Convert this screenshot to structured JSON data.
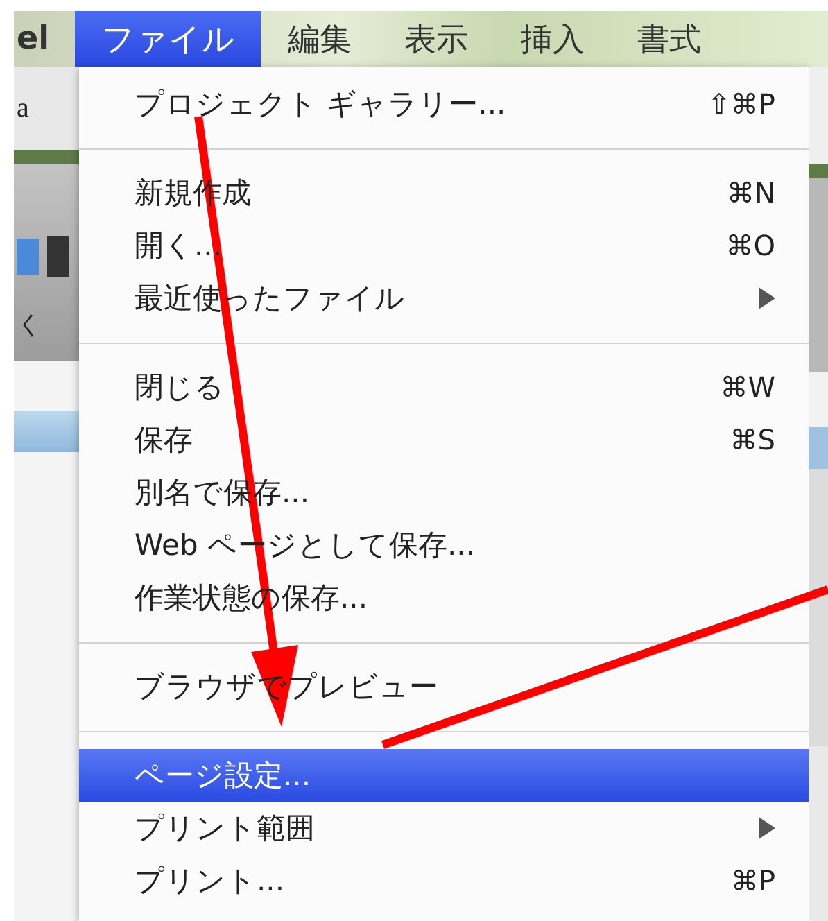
{
  "menubar": {
    "items": [
      {
        "label": "el",
        "selected": false
      },
      {
        "label": "ファイル",
        "selected": true
      },
      {
        "label": "編集",
        "selected": false
      },
      {
        "label": "表示",
        "selected": false
      },
      {
        "label": "挿入",
        "selected": false
      },
      {
        "label": "書式",
        "selected": false
      }
    ]
  },
  "background_window": {
    "field_text": "a",
    "toolbar_text": "く"
  },
  "menu": {
    "items": [
      {
        "kind": "item",
        "label": "プロジェクト ギャラリー...",
        "shortcut": "⇧⌘P",
        "submenu": false,
        "selected": false
      },
      {
        "kind": "separator"
      },
      {
        "kind": "item",
        "label": "新規作成",
        "shortcut": "⌘N",
        "submenu": false,
        "selected": false
      },
      {
        "kind": "item",
        "label": "開く...",
        "shortcut": "⌘O",
        "submenu": false,
        "selected": false
      },
      {
        "kind": "item",
        "label": "最近使ったファイル",
        "submenu": true,
        "selected": false
      },
      {
        "kind": "separator"
      },
      {
        "kind": "item",
        "label": "閉じる",
        "shortcut": "⌘W",
        "submenu": false,
        "selected": false
      },
      {
        "kind": "item",
        "label": "保存",
        "shortcut": "⌘S",
        "submenu": false,
        "selected": false
      },
      {
        "kind": "item",
        "label": "別名で保存...",
        "submenu": false,
        "selected": false
      },
      {
        "kind": "item",
        "label": "Web ページとして保存...",
        "submenu": false,
        "selected": false
      },
      {
        "kind": "item",
        "label": "作業状態の保存...",
        "submenu": false,
        "selected": false
      },
      {
        "kind": "separator"
      },
      {
        "kind": "item",
        "label": "ブラウザでプレビュー",
        "submenu": false,
        "selected": false
      },
      {
        "kind": "separator"
      },
      {
        "kind": "item",
        "label": "ページ設定...",
        "submenu": false,
        "selected": true
      },
      {
        "kind": "item",
        "label": "プリント範囲",
        "submenu": true,
        "selected": false
      },
      {
        "kind": "item",
        "label": "プリント...",
        "shortcut": "⌘P",
        "submenu": false,
        "selected": false
      }
    ]
  }
}
